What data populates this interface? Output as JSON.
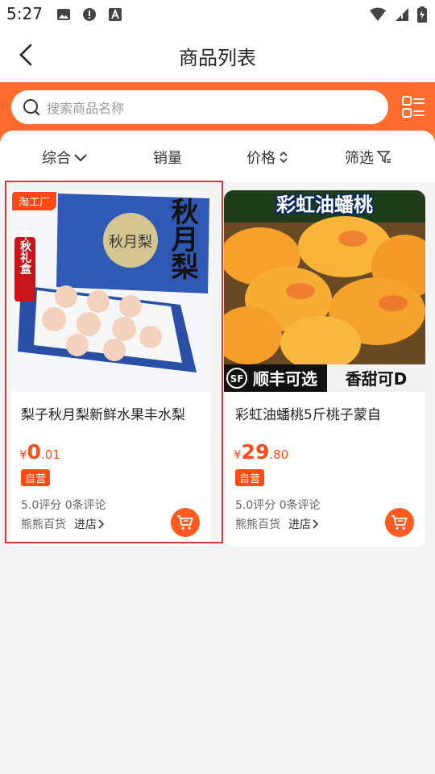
{
  "status": {
    "time": "5:27"
  },
  "header": {
    "title": "商品列表"
  },
  "search": {
    "placeholder": "搜索商品名称"
  },
  "sort": {
    "comprehensive": "综合",
    "sales": "销量",
    "price": "价格",
    "filter": "筛选"
  },
  "products": [
    {
      "tag": "淘工厂",
      "title": "梨子秋月梨新鲜水果丰水梨",
      "price_currency": "¥",
      "price_int": "0",
      "price_dec": ".01",
      "badge": "自营",
      "rating": "5.0评分 0条评论",
      "shop": "熊熊百货",
      "enter": "进店",
      "image_text": {
        "side": "中秋礼盒",
        "brand": "秋月梨",
        "small": "秋月梨"
      }
    },
    {
      "title": "彩虹油蟠桃5斤桃子蒙自",
      "price_currency": "¥",
      "price_int": "29",
      "price_dec": ".80",
      "badge": "自营",
      "rating": "5.0评分 0条评论",
      "shop": "熊熊百货",
      "enter": "进店",
      "image_text": {
        "top": "彩虹油蟠桃",
        "bottom_left": "顺丰可选",
        "bottom_right": "香甜可D"
      }
    }
  ],
  "colors": {
    "accent": "#ff6b2c",
    "price": "#ff4a16",
    "selected": "#d9363e"
  }
}
